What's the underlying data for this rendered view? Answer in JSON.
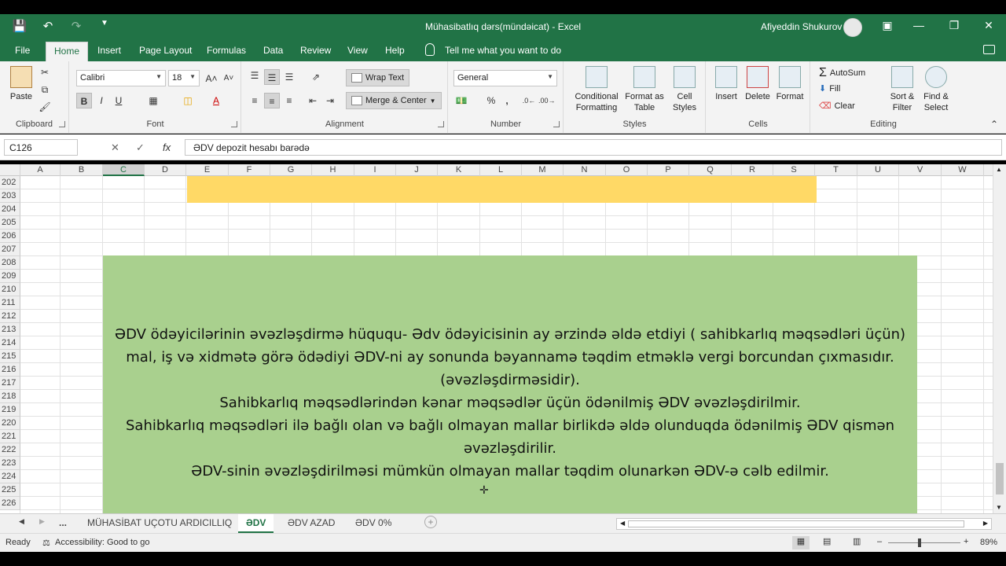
{
  "app": {
    "title": "Mühasibatlıq dərs(mündəicat)  -  Excel",
    "user": "Afiyeddin Shukurov"
  },
  "qat": {
    "save_icon": "save-icon",
    "undo_icon": "undo-icon",
    "redo_icon": "redo-icon",
    "customize_icon": "customize-icon"
  },
  "tabs": [
    "File",
    "Home",
    "Insert",
    "Page Layout",
    "Formulas",
    "Data",
    "Review",
    "View",
    "Help"
  ],
  "tell_me": "Tell me what you want to do",
  "ribbon": {
    "clipboard": {
      "label": "Clipboard",
      "paste": "Paste"
    },
    "font": {
      "label": "Font",
      "name": "Calibri",
      "size": "18",
      "bold": "B",
      "italic": "I",
      "underline": "U"
    },
    "alignment": {
      "label": "Alignment",
      "wrap": "Wrap Text",
      "merge": "Merge & Center"
    },
    "number": {
      "label": "Number",
      "format": "General",
      "percent": "%",
      "comma": ","
    },
    "styles": {
      "label": "Styles",
      "conditional": [
        "Conditional",
        "Formatting"
      ],
      "format_table": [
        "Format as",
        "Table"
      ],
      "cell_styles": [
        "Cell",
        "Styles"
      ]
    },
    "cells": {
      "label": "Cells",
      "insert": "Insert",
      "delete": "Delete",
      "format": "Format"
    },
    "editing": {
      "label": "Editing",
      "autosum": "AutoSum",
      "fill": "Fill",
      "clear": "Clear",
      "sort": [
        "Sort &",
        "Filter"
      ],
      "find": [
        "Find &",
        "Select"
      ]
    }
  },
  "formula_bar": {
    "name_box": "C126",
    "fx": "fx",
    "formula": "ƏDV depozit hesabı barədə"
  },
  "columns": [
    "A",
    "B",
    "C",
    "D",
    "E",
    "F",
    "G",
    "H",
    "I",
    "J",
    "K",
    "L",
    "M",
    "N",
    "O",
    "P",
    "Q",
    "R",
    "S",
    "T",
    "U",
    "V",
    "W"
  ],
  "rows": [
    "202",
    "203",
    "204",
    "205",
    "206",
    "207",
    "208",
    "209",
    "210",
    "211",
    "212",
    "213",
    "214",
    "215",
    "216",
    "217",
    "218",
    "219",
    "220",
    "221",
    "222",
    "223",
    "224",
    "225",
    "226"
  ],
  "green_text": [
    "ƏDV ödəyicilərinin əvəzləşdirmə hüququ- Ədv ödəyicisinin ay ərzində əldə etdiyi ( sahibkarlıq məqsədləri üçün)",
    "mal, iş və xidmətə görə ödədiyi ƏDV-ni ay sonunda bəyannamə təqdim etməklə vergi  borcundan çıxmasıdır.",
    "(əvəzləşdirməsidir).",
    "Sahibkarlıq məqsədlərindən kənar məqsədlər üçün ödənilmiş ƏDV əvəzləşdirilmir.",
    "Sahibkarlıq məqsədləri ilə bağlı olan və bağlı olmayan mallar birlikdə əldə olunduqda ödənilmiş ƏDV qismən",
    "əvəzləşdirilir.",
    "ƏDV-sinin əvəzləşdirilməsi mümkün olmayan mallar təqdim olunarkən ƏDV-ə cəlb edilmir."
  ],
  "sheets": [
    "...",
    "MÜHASİBAT UÇOTU ARDICILLIQ",
    "ƏDV",
    "ƏDV AZAD",
    "ƏDV 0%"
  ],
  "status": {
    "ready": "Ready",
    "accessibility": "Accessibility: Good to go",
    "zoom": "89%"
  },
  "colors": {
    "excel_green": "#217346",
    "yellow_fill": "#ffd966",
    "green_fill": "#a9d08e"
  }
}
